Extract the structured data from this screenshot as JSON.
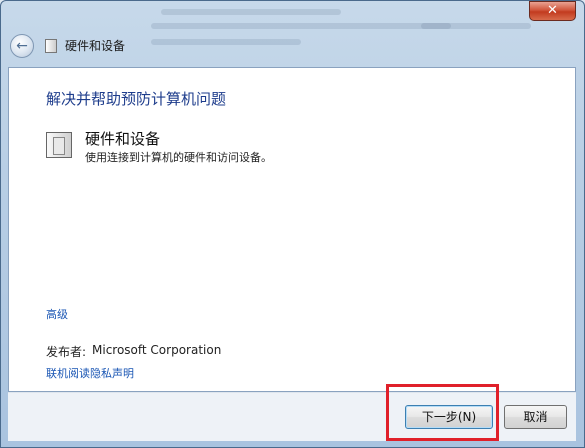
{
  "window": {
    "close_glyph": "✕"
  },
  "nav": {
    "back_glyph": "←",
    "title": "硬件和设备"
  },
  "content": {
    "heading": "解决并帮助预防计算机问题",
    "item": {
      "title": "硬件和设备",
      "description": "使用连接到计算机的硬件和访问设备。"
    },
    "advanced_link": "高级",
    "publisher_label": "发布者:",
    "publisher_value": "Microsoft Corporation",
    "privacy_link": "联机阅读隐私声明"
  },
  "footer": {
    "next_label": "下一步(N)",
    "cancel_label": "取消"
  },
  "colors": {
    "heading": "#1e3d8c",
    "link": "#1a56b4",
    "highlight": "#e0202a"
  }
}
